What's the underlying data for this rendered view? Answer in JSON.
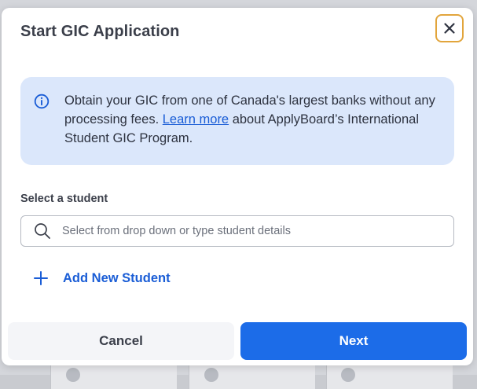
{
  "modal": {
    "title": "Start GIC Application",
    "close_icon": "close-icon"
  },
  "info": {
    "icon": "info-icon",
    "text_before": "Obtain your GIC from one of Canada's largest banks without any processing fees. ",
    "link_text": "Learn more",
    "text_after": " about ApplyBoard’s International Student GIC Program."
  },
  "student_select": {
    "label": "Select a student",
    "placeholder": "Select from drop down or type student details",
    "value": "",
    "icon": "search-icon"
  },
  "add_student": {
    "icon": "plus-icon",
    "label": "Add New Student"
  },
  "footer": {
    "cancel_label": "Cancel",
    "next_label": "Next"
  },
  "colors": {
    "accent": "#1c6ce8",
    "link": "#1a5dd6",
    "info_bg": "#dbe7fb",
    "focus_ring": "#e2a53c",
    "text": "#3b3f4a"
  }
}
